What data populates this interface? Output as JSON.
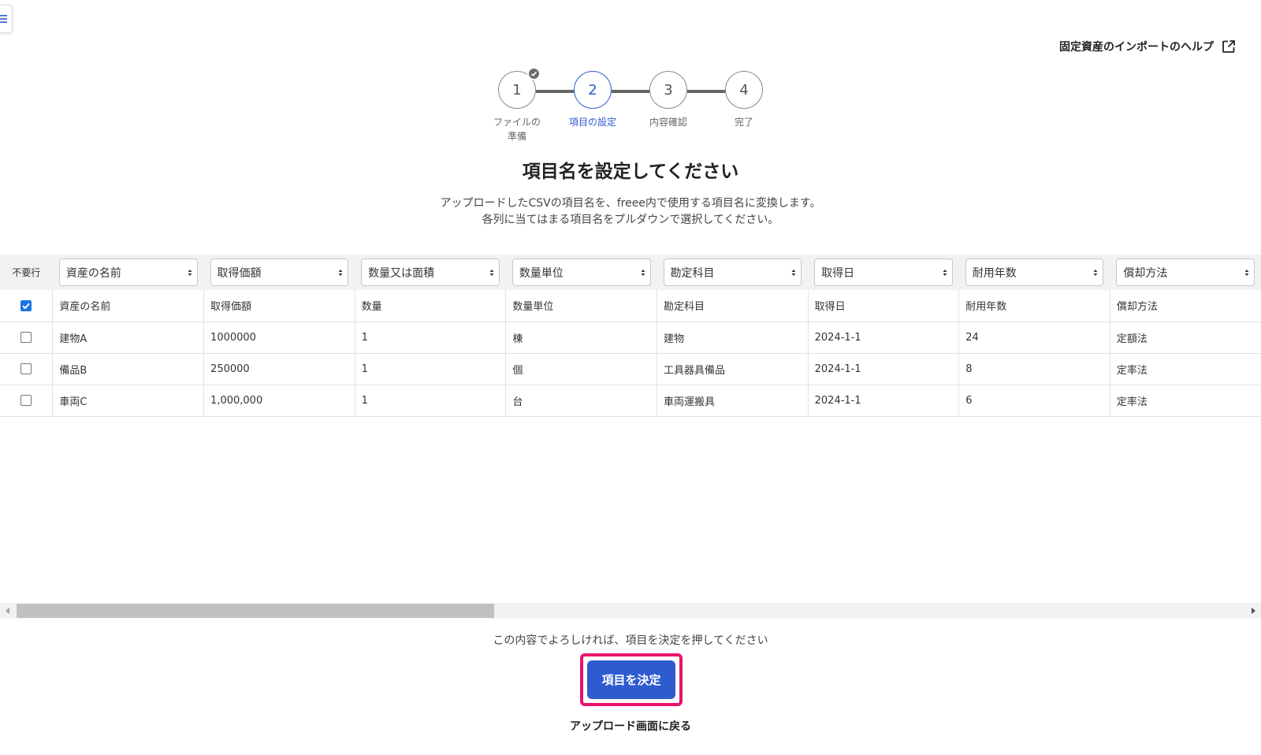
{
  "help": {
    "label": "固定資産のインポートのヘルプ",
    "icon": "external-link-icon"
  },
  "stepper": {
    "steps": [
      {
        "number": "1",
        "label_line1": "ファイルの",
        "label_line2": "準備",
        "state": "completed"
      },
      {
        "number": "2",
        "label_line1": "項目の設定",
        "label_line2": "",
        "state": "active"
      },
      {
        "number": "3",
        "label_line1": "内容確認",
        "label_line2": "",
        "state": "pending"
      },
      {
        "number": "4",
        "label_line1": "完了",
        "label_line2": "",
        "state": "pending"
      }
    ]
  },
  "page": {
    "title": "項目名を設定してください",
    "description_line1": "アップロードしたCSVの項目名を、freee内で使用する項目名に変換します。",
    "description_line2": "各列に当てはまる項目名をプルダウンで選択してください。"
  },
  "table": {
    "skip_header": "不要行",
    "selects": [
      "資産の名前",
      "取得価額",
      "数量又は面積",
      "数量単位",
      "勘定科目",
      "取得日",
      "耐用年数",
      "償却方法"
    ],
    "rows": [
      {
        "checked": true,
        "cells": [
          "資産の名前",
          "取得価額",
          "数量",
          "数量単位",
          "勘定科目",
          "取得日",
          "耐用年数",
          "償却方法"
        ]
      },
      {
        "checked": false,
        "cells": [
          "建物A",
          "1000000",
          "1",
          "棟",
          "建物",
          "2024-1-1",
          "24",
          "定額法"
        ]
      },
      {
        "checked": false,
        "cells": [
          "備品B",
          "250000",
          "1",
          "個",
          "工具器具備品",
          "2024-1-1",
          "8",
          "定率法"
        ]
      },
      {
        "checked": false,
        "cells": [
          "車両C",
          "1,000,000",
          "1",
          "台",
          "車両運搬具",
          "2024-1-1",
          "6",
          "定率法"
        ]
      }
    ]
  },
  "footer": {
    "confirm_text": "この内容でよろしければ、項目を決定を押してください",
    "decide_label": "項目を決定",
    "back_label": "アップロード画面に戻る"
  },
  "colors": {
    "accent": "#2f5bd1",
    "highlight": "#e8136a",
    "checkbox": "#1a73e8"
  }
}
